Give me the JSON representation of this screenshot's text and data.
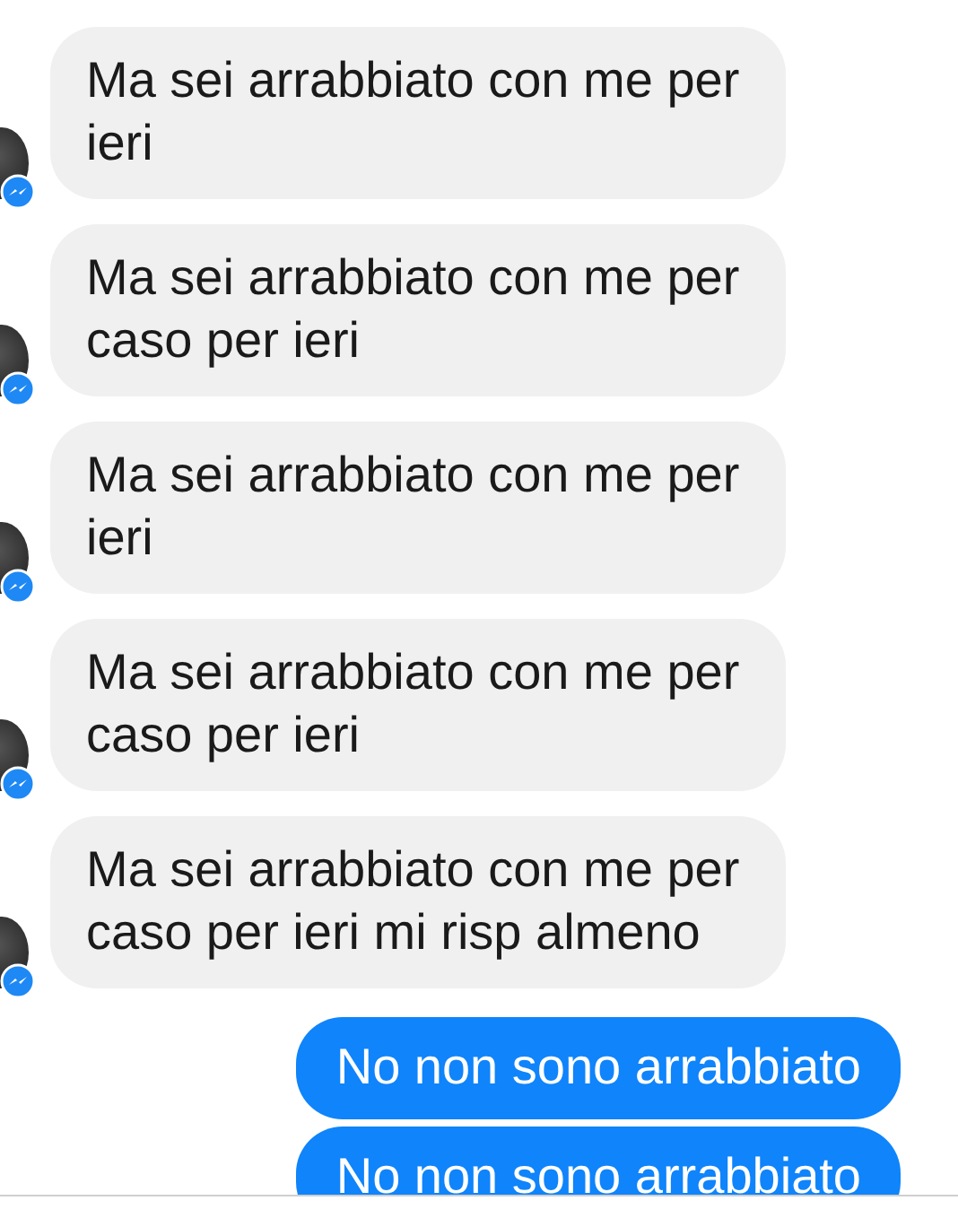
{
  "messages": [
    {
      "kind": "incoming",
      "text": "Ma sei arrabbiato con me per ieri"
    },
    {
      "kind": "incoming",
      "text": "Ma sei arrabbiato con me per caso per ieri"
    },
    {
      "kind": "incoming",
      "text": "Ma sei arrabbiato con me per ieri"
    },
    {
      "kind": "incoming",
      "text": "Ma sei arrabbiato con me per caso per ieri"
    },
    {
      "kind": "incoming",
      "text": "Ma sei arrabbiato con me per caso per ieri  mi risp almeno"
    },
    {
      "kind": "outgoing",
      "text": "No non sono arrabbiato"
    },
    {
      "kind": "outgoing",
      "text": "No non sono arrabbiato"
    }
  ]
}
